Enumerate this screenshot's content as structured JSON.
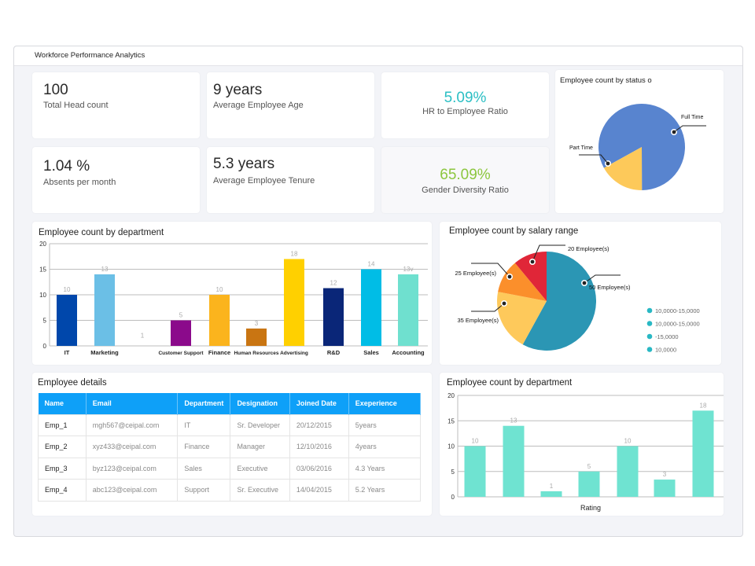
{
  "app": {
    "title": "Workforce Performance Analytics"
  },
  "kpis": [
    {
      "value": "100",
      "label": "Total Head count"
    },
    {
      "value": "9 years",
      "label": "Average Employee Age"
    },
    {
      "value": "5.09%",
      "label": "HR to Employee Ratio",
      "color": "#2bbfc4"
    },
    {
      "value": "1.04 %",
      "label": "Absents per month"
    },
    {
      "value": "5.3 years",
      "label": "Average Employee Tenure"
    },
    {
      "value": "65.09%",
      "label": "Gender Diversity Ratio",
      "color": "#8cc63f"
    }
  ],
  "chart_data": [
    {
      "id": "status_pie",
      "type": "pie",
      "title": "Employee count by status o",
      "slices": [
        {
          "label": "Full Time",
          "value": 83,
          "color": "#5884cf"
        },
        {
          "label": "Part Time",
          "value": 17,
          "color": "#fdc95a"
        }
      ]
    },
    {
      "id": "dept_bar",
      "type": "bar",
      "title": "Employee count by department",
      "categories": [
        "IT",
        "Marketing",
        "",
        "Customer Support",
        "Finance",
        "Human Resources",
        "Advertising",
        "R&D",
        "Sales",
        "Accounting"
      ],
      "values": [
        10,
        14,
        0,
        5,
        10,
        3.4,
        17,
        11.3,
        15,
        14
      ],
      "data_labels": [
        "10",
        "13",
        "1",
        "5",
        "10",
        "3",
        "18",
        "12",
        "14",
        "13v"
      ],
      "colors": [
        "#0047ab",
        "#6bbfe6",
        "#cccccc",
        "#8b0a8b",
        "#fbb41d",
        "#c97512",
        "#ffd000",
        "#0a2678",
        "#00bde6",
        "#6fe0cf"
      ],
      "yticks": [
        0,
        5,
        10,
        15,
        20
      ],
      "ylim": [
        0,
        20
      ],
      "grid": true
    },
    {
      "id": "salary_pie",
      "type": "pie",
      "title": "Employee count by salary range",
      "slices": [
        {
          "label": "50 Employee(s)",
          "value": 58,
          "color": "#2b96b4"
        },
        {
          "label": "35 Employee(s)",
          "value": 20,
          "color": "#fec95b"
        },
        {
          "label": "25 Employee(s)",
          "value": 11,
          "color": "#fb8f2b"
        },
        {
          "label": "20 Employee(s)",
          "value": 11,
          "color": "#e02638"
        }
      ],
      "legend": {
        "position": "bottom-right",
        "color": "#29b8c4",
        "items": [
          "10,0000-15,0000",
          "10,0000-15,0000",
          "-15,0000",
          "10,0000"
        ]
      }
    },
    {
      "id": "rating_bar",
      "type": "bar",
      "title": "Employee count by department",
      "xlabel": "Rating",
      "values": [
        10,
        14,
        1.1,
        5,
        10,
        3.4,
        17
      ],
      "data_labels": [
        "10",
        "13",
        "1",
        "5",
        "10",
        "3",
        "18"
      ],
      "color": "#6fe3d1",
      "yticks": [
        0,
        5,
        10,
        15,
        20
      ],
      "ylim": [
        0,
        20
      ],
      "grid": true
    }
  ],
  "table": {
    "title": "Employee details",
    "columns": [
      "Name",
      "Email",
      "Department",
      "Designation",
      "Joined Date",
      "Exeperience"
    ],
    "rows": [
      [
        "Emp_1",
        "mgh567@ceipal.com",
        "IT",
        "Sr. Developer",
        "20/12/2015",
        "5years"
      ],
      [
        "Emp_2",
        "xyz433@ceipal.com",
        "Finance",
        "Manager",
        "12/10/2016",
        "4years"
      ],
      [
        "Emp_3",
        "byz123@ceipal.com",
        "Sales",
        "Executive",
        "03/06/2016",
        "4.3 Years"
      ],
      [
        "Emp_4",
        "abc123@ceipal.com",
        "Support",
        "Sr. Executive",
        "14/04/2015",
        "5.2 Years"
      ]
    ]
  }
}
